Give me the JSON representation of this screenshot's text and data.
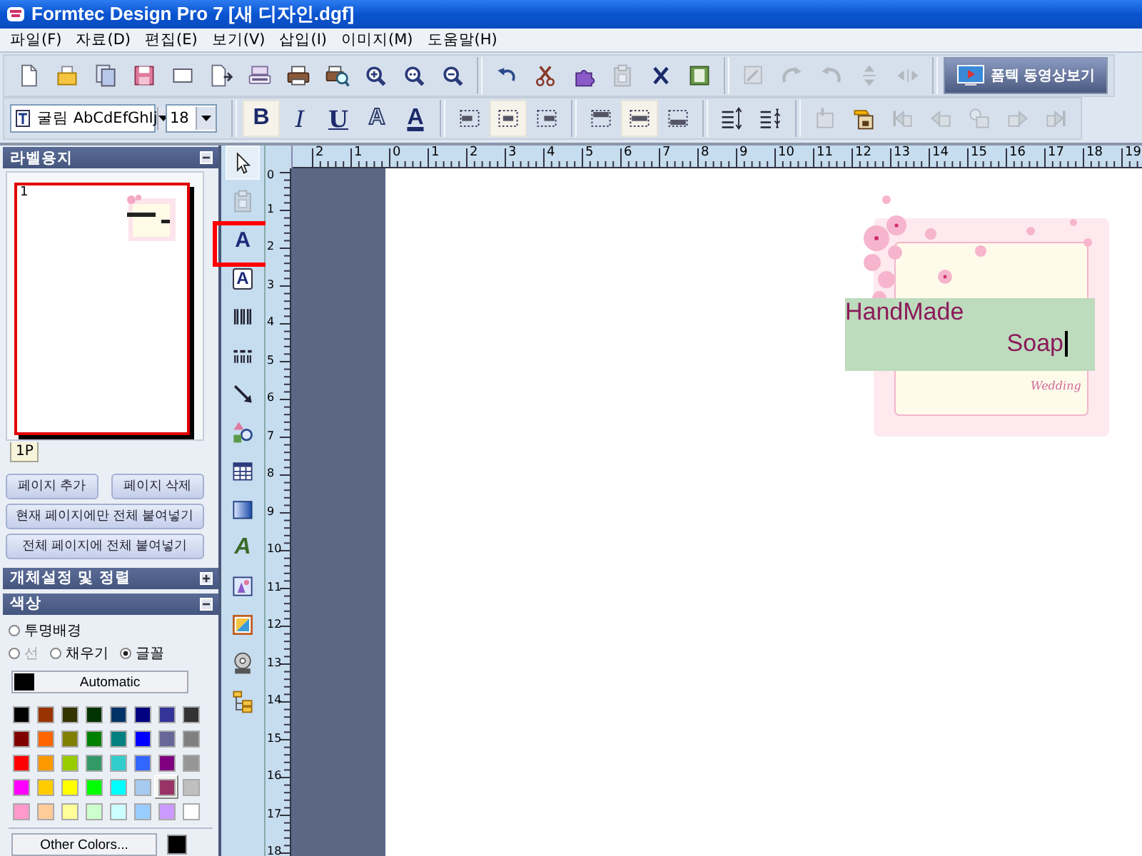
{
  "window": {
    "title": "Formtec Design Pro 7 [새 디자인.dgf]"
  },
  "menu": [
    "파일(F)",
    "자료(D)",
    "편집(E)",
    "보기(V)",
    "삽입(I)",
    "이미지(M)",
    "도움말(H)"
  ],
  "toolbar_1": [
    {
      "disabled": false
    },
    {
      "disabled": false
    },
    {
      "disabled": false
    },
    {
      "disabled": false
    },
    {
      "disabled": false
    },
    {
      "disabled": false
    },
    {
      "disabled": false
    },
    {
      "disabled": false
    },
    {
      "disabled": false
    },
    {
      "disabled": false
    },
    {
      "disabled": false
    },
    {
      "disabled": false
    },
    {
      "disabled": false
    },
    {
      "disabled": false
    },
    {
      "disabled": false
    },
    {
      "disabled": true
    },
    {
      "disabled": false
    },
    {
      "disabled": false
    },
    {
      "disabled": true
    },
    {
      "disabled": true
    },
    {
      "disabled": true
    },
    {
      "disabled": true
    },
    {
      "disabled": true
    }
  ],
  "video_button": {
    "label": "폼텍 동영상보기"
  },
  "font_name": "굴림 AbCdEfGhIj",
  "font_size": "18",
  "format_buttons": [
    {
      "label": "B",
      "selected": true
    },
    {
      "label": "I",
      "selected": false
    },
    {
      "label": "U",
      "selected": false
    },
    {
      "label": "A",
      "selected": false
    },
    {
      "label": "A",
      "selected": false
    }
  ],
  "align_buttons": [
    {
      "selected": false
    },
    {
      "selected": true
    },
    {
      "selected": false
    }
  ],
  "valign_buttons": [
    {
      "selected": false
    },
    {
      "selected": true
    },
    {
      "selected": false
    }
  ],
  "object_buttons": [
    {
      "disabled": true
    },
    {
      "disabled": false
    },
    {
      "disabled": true
    },
    {
      "disabled": true
    },
    {
      "disabled": true
    },
    {
      "disabled": true
    },
    {
      "disabled": true
    }
  ],
  "label_paper_panel": {
    "title": "라벨용지",
    "expanded": true,
    "page_number": "1",
    "tab": "1P",
    "buttons": [
      "페이지 추가",
      "페이지 삭제",
      "현재 페이지에만 전체 붙여넣기",
      "전체 페이지에 전체 붙여넣기"
    ]
  },
  "object_panel": {
    "title": "개체설정 및 정렬",
    "expanded": false
  },
  "color_panel": {
    "title": "색상",
    "expanded": true,
    "options": [
      {
        "label": "투명배경",
        "selected": false,
        "disabled": false
      },
      {
        "label": "선",
        "selected": false,
        "disabled": true
      },
      {
        "label": "채우기",
        "selected": false,
        "disabled": false
      },
      {
        "label": "글꼴",
        "selected": true,
        "disabled": false
      }
    ],
    "automatic": {
      "label": "Automatic",
      "color": "#000000"
    },
    "other_colors": "Other Colors...",
    "current": {
      "color": "#000000"
    },
    "swatches": [
      {
        "color": "#000000",
        "selected": false
      },
      {
        "color": "#993300",
        "selected": false
      },
      {
        "color": "#333300",
        "selected": false
      },
      {
        "color": "#003300",
        "selected": false
      },
      {
        "color": "#003366",
        "selected": false
      },
      {
        "color": "#000080",
        "selected": false
      },
      {
        "color": "#333399",
        "selected": false
      },
      {
        "color": "#333333",
        "selected": false
      },
      {
        "color": "#800000",
        "selected": false
      },
      {
        "color": "#ff6600",
        "selected": false
      },
      {
        "color": "#808000",
        "selected": false
      },
      {
        "color": "#008000",
        "selected": false
      },
      {
        "color": "#008080",
        "selected": false
      },
      {
        "color": "#0000ff",
        "selected": false
      },
      {
        "color": "#666699",
        "selected": false
      },
      {
        "color": "#808080",
        "selected": false
      },
      {
        "color": "#ff0000",
        "selected": false
      },
      {
        "color": "#ff9900",
        "selected": false
      },
      {
        "color": "#99cc00",
        "selected": false
      },
      {
        "color": "#339966",
        "selected": false
      },
      {
        "color": "#33cccc",
        "selected": false
      },
      {
        "color": "#3366ff",
        "selected": false
      },
      {
        "color": "#800080",
        "selected": false
      },
      {
        "color": "#969696",
        "selected": false
      },
      {
        "color": "#ff00ff",
        "selected": false
      },
      {
        "color": "#ffcc00",
        "selected": false
      },
      {
        "color": "#ffff00",
        "selected": false
      },
      {
        "color": "#00ff00",
        "selected": false
      },
      {
        "color": "#00ffff",
        "selected": false
      },
      {
        "color": "#a6caf0",
        "selected": false
      },
      {
        "color": "#993366",
        "selected": true
      },
      {
        "color": "#c0c0c0",
        "selected": false
      },
      {
        "color": "#ff99cc",
        "selected": false
      },
      {
        "color": "#ffcc99",
        "selected": false
      },
      {
        "color": "#ffff99",
        "selected": false
      },
      {
        "color": "#ccffcc",
        "selected": false
      },
      {
        "color": "#ccffff",
        "selected": false
      },
      {
        "color": "#99ccff",
        "selected": false
      },
      {
        "color": "#cc99ff",
        "selected": false
      },
      {
        "color": "#ffffff",
        "selected": false
      }
    ]
  },
  "tools": [
    {
      "selected": true,
      "disabled": false
    },
    {
      "selected": false,
      "disabled": true
    },
    {
      "label": "A",
      "selected": false,
      "disabled": false
    },
    {
      "label": "A",
      "selected": false,
      "disabled": false
    },
    {
      "selected": false,
      "disabled": false
    },
    {
      "selected": false,
      "disabled": false
    },
    {
      "selected": false,
      "disabled": false
    },
    {
      "selected": false,
      "disabled": false
    },
    {
      "selected": false,
      "disabled": false
    },
    {
      "selected": false,
      "disabled": false
    },
    {
      "label": "A",
      "selected": false,
      "disabled": false
    },
    {
      "selected": false,
      "disabled": false
    },
    {
      "selected": false,
      "disabled": false
    },
    {
      "selected": false,
      "disabled": false
    },
    {
      "selected": false,
      "disabled": false
    }
  ],
  "top_ruler": [
    "2",
    "1",
    "0",
    "1",
    "2",
    "3",
    "4",
    "5",
    "6",
    "7",
    "8",
    "9",
    "10",
    "11",
    "12",
    "13",
    "14",
    "15",
    "16",
    "17",
    "18",
    "19"
  ],
  "left_ruler": [
    "0",
    "1",
    "2",
    "3",
    "4",
    "5",
    "6",
    "7",
    "8",
    "9",
    "10",
    "11",
    "12",
    "13",
    "14",
    "15",
    "16",
    "17",
    "18"
  ],
  "canvas": {
    "text_box": {
      "line_1": "HandMade",
      "line_2": "Soap",
      "editing": true
    },
    "label_script": "Wedding"
  }
}
